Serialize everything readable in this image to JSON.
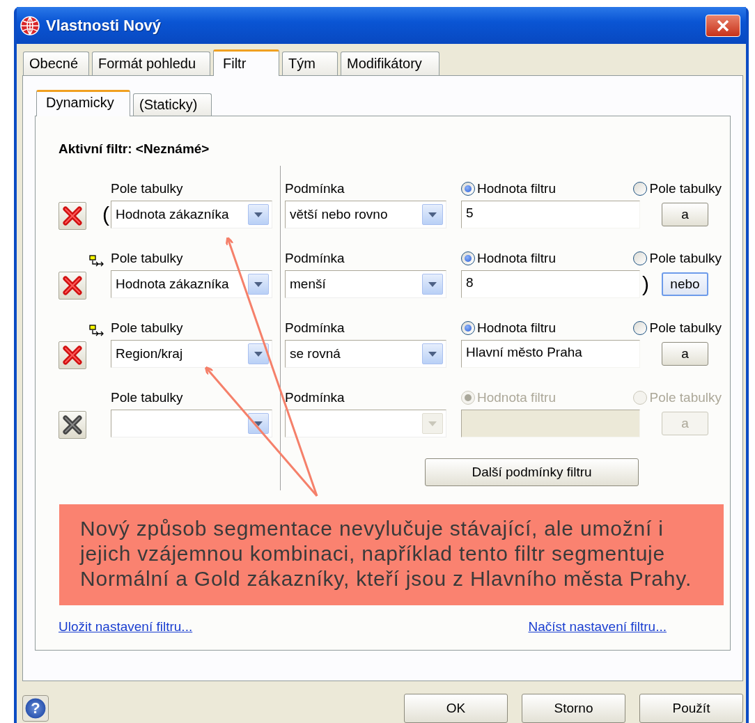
{
  "window": {
    "title": "Vlastnosti Nový"
  },
  "tabs": [
    {
      "label": "Obecné",
      "selected": false
    },
    {
      "label": "Formát pohledu",
      "selected": false
    },
    {
      "label": "Filtr",
      "selected": true
    },
    {
      "label": "Tým",
      "selected": false
    },
    {
      "label": "Modifikátory",
      "selected": false
    }
  ],
  "subtabs": [
    {
      "label": "Dynamicky",
      "selected": true
    },
    {
      "label": "(Staticky)",
      "selected": false
    }
  ],
  "active_filter": "Aktivní filtr: <Neznámé>",
  "conditions": [
    {
      "disabled": false,
      "open_paren": "(",
      "field_label": "Pole tabulky",
      "field": "Hodnota zákazníka",
      "condition_label": "Podmínka",
      "condition": "větší nebo rovno",
      "sources": [
        {
          "label": "Hodnota filtru",
          "selected": true
        },
        {
          "label": "Pole tabulky",
          "selected": false
        }
      ],
      "value": "5",
      "connector": {
        "label": "a",
        "focused": false
      }
    },
    {
      "disabled": false,
      "linked": true,
      "field_label": "Pole tabulky",
      "field": "Hodnota zákazníka",
      "condition_label": "Podmínka",
      "condition": "menší",
      "sources": [
        {
          "label": "Hodnota filtru",
          "selected": true
        },
        {
          "label": "Pole tabulky",
          "selected": false
        }
      ],
      "value": "8",
      "close_paren": ")",
      "connector": {
        "label": "nebo",
        "focused": true
      }
    },
    {
      "disabled": false,
      "linked": true,
      "field_label": "Pole tabulky",
      "field": "Region/kraj",
      "condition_label": "Podmínka",
      "condition": "se rovná",
      "sources": [
        {
          "label": "Hodnota filtru",
          "selected": true
        },
        {
          "label": "Pole tabulky",
          "selected": false
        }
      ],
      "value": "Hlavní město Praha",
      "connector": {
        "label": "a",
        "focused": false
      }
    },
    {
      "disabled": true,
      "field_label": "Pole tabulky",
      "condition_label": "Podmínka",
      "sources": [
        {
          "label": "Hodnota filtru",
          "selected": true
        },
        {
          "label": "Pole tabulky",
          "selected": false
        }
      ],
      "connector": {
        "label": "a",
        "focused": false
      }
    }
  ],
  "more_button": "Další podmínky filtru",
  "callout": "Nový způsob segmentace nevylučuje stávající, ale umožní i jejich vzájemnou kombinaci, například tento filtr segmentuje Normální a Gold zákazníky, kteří jsou z Hlavního města Prahy.",
  "links": [
    "Uložit nastavení filtru...",
    "Načíst nastavení filtru..."
  ],
  "help_button": "?",
  "buttons": [
    "OK",
    "Storno",
    "Použít"
  ]
}
